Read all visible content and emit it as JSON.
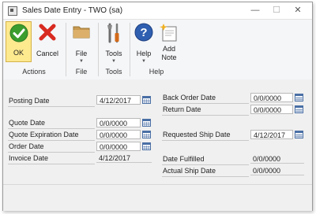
{
  "window": {
    "title": "Sales Date Entry  -  TWO (sa)"
  },
  "ribbon": {
    "ok_label": "OK",
    "cancel_label": "Cancel",
    "file_label": "File",
    "tools_label": "Tools",
    "help_label": "Help",
    "add_note_line1": "Add",
    "add_note_line2": "Note",
    "groups": {
      "actions": "Actions",
      "file": "File",
      "tools": "Tools",
      "help": "Help"
    }
  },
  "left_fields": {
    "posting_date": {
      "label": "Posting Date",
      "value": "4/12/2017"
    },
    "quote_date": {
      "label": "Quote Date",
      "value": "0/0/0000"
    },
    "quote_expiration_date": {
      "label": "Quote Expiration Date",
      "value": "0/0/0000"
    },
    "order_date": {
      "label": "Order Date",
      "value": "0/0/0000"
    },
    "invoice_date": {
      "label": "Invoice Date",
      "value": "4/12/2017"
    }
  },
  "right_fields": {
    "back_order_date": {
      "label": "Back Order Date",
      "value": "0/0/0000"
    },
    "return_date": {
      "label": "Return Date",
      "value": "0/0/0000"
    },
    "requested_ship_date": {
      "label": "Requested Ship Date",
      "value": "4/12/2017"
    },
    "date_fulfilled": {
      "label": "Date Fulfilled",
      "value": "0/0/0000"
    },
    "actual_ship_date": {
      "label": "Actual Ship Date",
      "value": "0/0/0000"
    }
  }
}
